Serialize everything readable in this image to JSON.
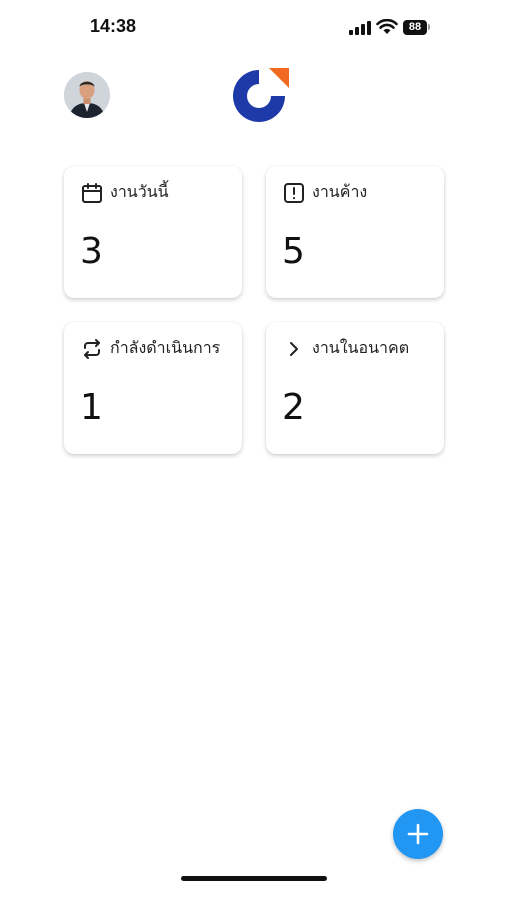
{
  "status_bar": {
    "time": "14:38",
    "battery": "88"
  },
  "header": {
    "avatar_icon": "user-avatar",
    "logo_icon": "brand-logo"
  },
  "colors": {
    "logo_blue": "#1e3aa8",
    "logo_orange": "#f26a21",
    "fab": "#2196f3"
  },
  "cards": [
    {
      "label": "งานวันนี้",
      "count": "3",
      "icon": "calendar-icon"
    },
    {
      "label": "งานค้าง",
      "count": "5",
      "icon": "alert-icon"
    },
    {
      "label": "กำลังดำเนินการ",
      "count": "1",
      "icon": "repeat-icon"
    },
    {
      "label": "งานในอนาคต",
      "count": "2",
      "icon": "chevron-right-icon"
    }
  ],
  "fab": {
    "icon": "plus-icon"
  }
}
